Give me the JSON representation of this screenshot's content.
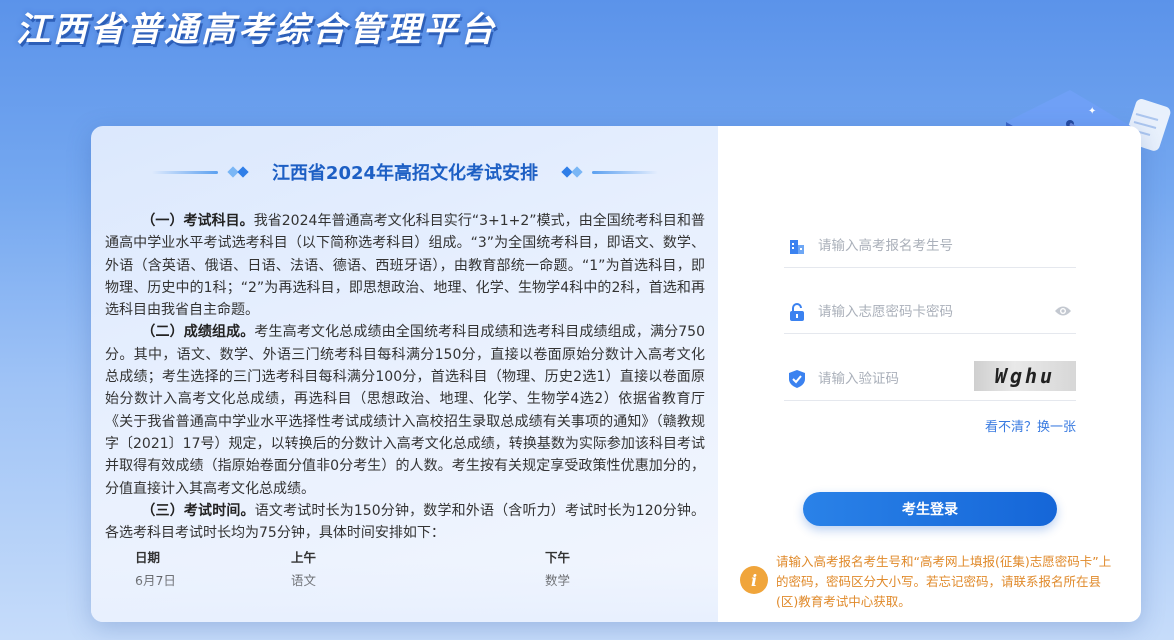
{
  "header": {
    "title": "江西省普通高考综合管理平台"
  },
  "notice": {
    "title": "江西省2024年高招文化考试安排",
    "paragraphs": [
      {
        "lead": "（一）考试科目。",
        "text": "我省2024年普通高考文化科目实行“3+1+2”模式，由全国统考科目和普通高中学业水平考试选考科目（以下简称选考科目）组成。“3”为全国统考科目，即语文、数学、外语（含英语、俄语、日语、法语、德语、西班牙语），由教育部统一命题。“1”为首选科目，即物理、历史中的1科；“2”为再选科目，即思想政治、地理、化学、生物学4科中的2科，首选和再选科目由我省自主命题。"
      },
      {
        "lead": "（二）成绩组成。",
        "text": "考生高考文化总成绩由全国统考科目成绩和选考科目成绩组成，满分750分。其中，语文、数学、外语三门统考科目每科满分150分，直接以卷面原始分数计入高考文化总成绩；考生选择的三门选考科目每科满分100分，首选科目（物理、历史2选1）直接以卷面原始分数计入高考文化总成绩，再选科目（思想政治、地理、化学、生物学4选2）依据省教育厅《关于我省普通高中学业水平选择性考试成绩计入高校招生录取总成绩有关事项的通知》（赣教规字〔2021〕17号）规定，以转换后的分数计入高考文化总成绩，转换基数为实际参加该科目考试并取得有效成绩（指原始卷面分值非0分考生）的人数。考生按有关规定享受政策性优惠加分的，分值直接计入其高考文化总成绩。"
      },
      {
        "lead": "（三）考试时间。",
        "text": "语文考试时长为150分钟，数学和外语（含听力）考试时长为120分钟。各选考科目考试时长均为75分钟，具体时间安排如下："
      }
    ],
    "schedule": {
      "headers": [
        "日期",
        "上午",
        "下午"
      ],
      "rows": [
        [
          "6月7日",
          "语文",
          "数学"
        ]
      ]
    }
  },
  "login": {
    "exam_id_placeholder": "请输入高考报名考生号",
    "password_placeholder": "请输入志愿密码卡密码",
    "captcha_placeholder": "请输入验证码",
    "captcha_text": "Wghu",
    "refresh_label": "看不清？换一张",
    "submit_label": "考生登录",
    "tip": "请输入高考报名考生号和“高考网上填报(征集)志愿密码卡”上的密码，密码区分大小写。若忘记密码，请联系报名所在县(区)教育考试中心获取。",
    "info_symbol": "i"
  },
  "colors": {
    "accent": "#1d6fe0",
    "title_blue": "#1d5fc4",
    "tip_orange": "#e08a2b",
    "icon_orange": "#f0a53b"
  }
}
